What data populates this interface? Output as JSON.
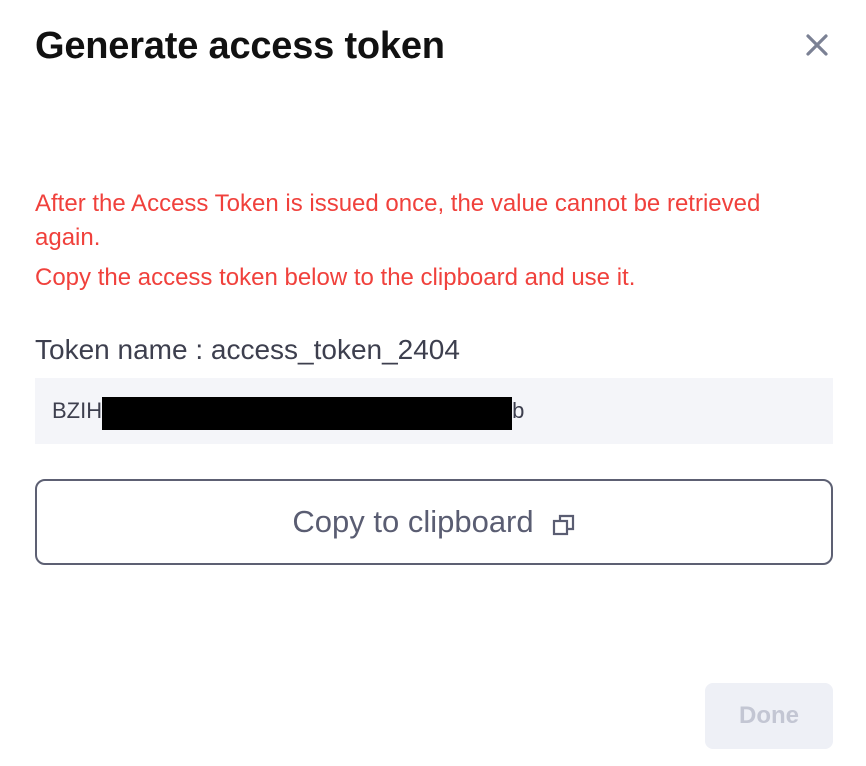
{
  "dialog": {
    "title": "Generate access token",
    "close_icon": "close-icon"
  },
  "warning": {
    "line1": "After the Access Token is issued once, the value cannot be retrieved again.",
    "line2": "Copy the access token below to the clipboard and use it."
  },
  "token": {
    "name_label": "Token name : access_token_2404",
    "value_prefix": "BZIH",
    "value_suffix": "b"
  },
  "copy_button": {
    "label": "Copy to clipboard",
    "icon": "copy-icon"
  },
  "done_button": {
    "label": "Done",
    "disabled": true
  },
  "colors": {
    "warning": "#f0413c",
    "title": "#111111",
    "token_bg": "#f4f5f9",
    "done_bg": "#eef0f6",
    "done_text": "#c3c6d3"
  }
}
